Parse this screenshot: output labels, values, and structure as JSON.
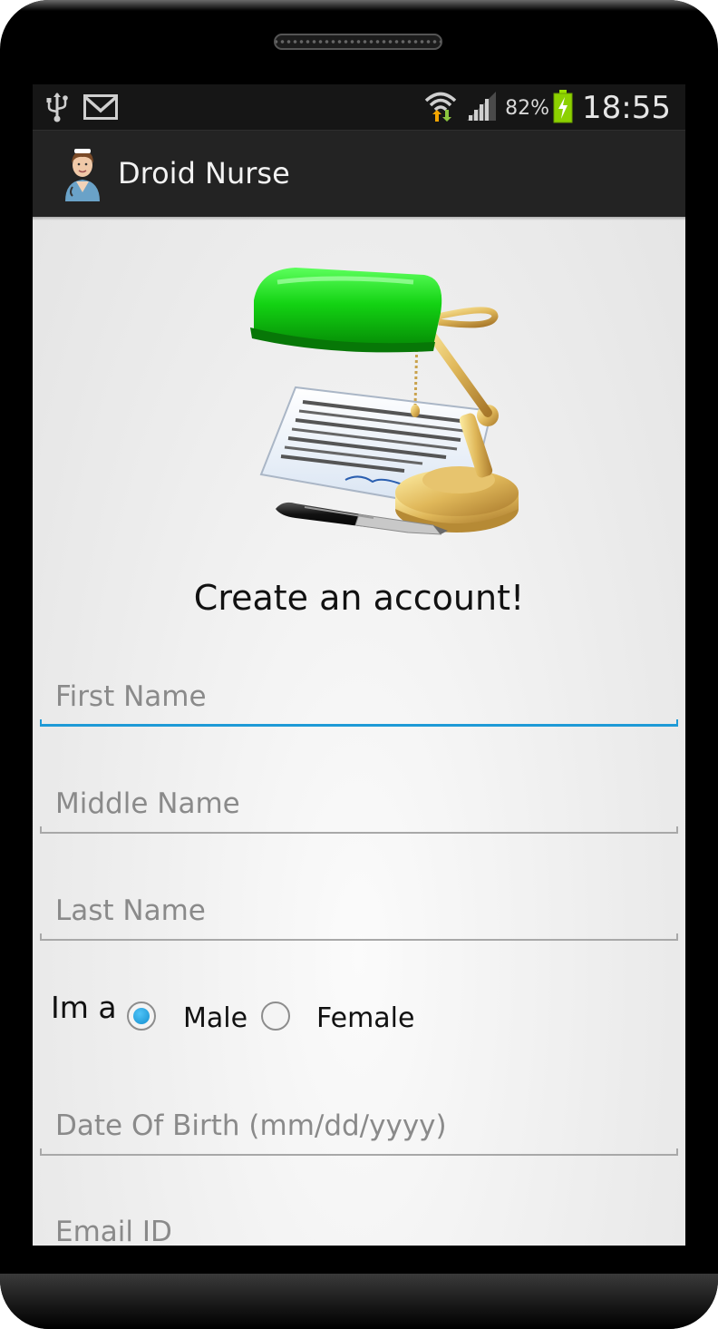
{
  "status_bar": {
    "battery_percent": "82%",
    "time": "18:55",
    "icons": [
      "usb-icon",
      "gmail-icon",
      "wifi-icon",
      "signal-icon",
      "battery-charging-icon"
    ]
  },
  "action_bar": {
    "title": "Droid Nurse",
    "icon": "nurse-avatar-icon"
  },
  "form": {
    "heading": "Create an account!",
    "first_name_placeholder": "First Name",
    "middle_name_placeholder": "Middle Name",
    "last_name_placeholder": "Last Name",
    "gender_label": "Im a",
    "gender_options": [
      {
        "label": "Male",
        "selected": true
      },
      {
        "label": "Female",
        "selected": false
      }
    ],
    "dob_placeholder": "Date Of Birth (mm/dd/yyyy)",
    "email_placeholder": "Email ID"
  },
  "colors": {
    "accent": "#1e9ad6",
    "action_bar_bg": "#232323",
    "status_bar_bg": "#161616"
  }
}
